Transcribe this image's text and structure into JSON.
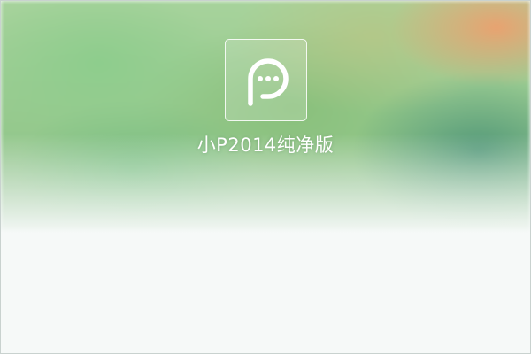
{
  "app": {
    "title": "小P2014纯净版",
    "logo_icon": "chat-bubble-p-icon"
  },
  "colors": {
    "title_text": "#ffffff",
    "background": "#f6f9f8",
    "banner_green": "#95c98d",
    "banner_orange": "#eca06e",
    "banner_teal": "#50967a"
  }
}
